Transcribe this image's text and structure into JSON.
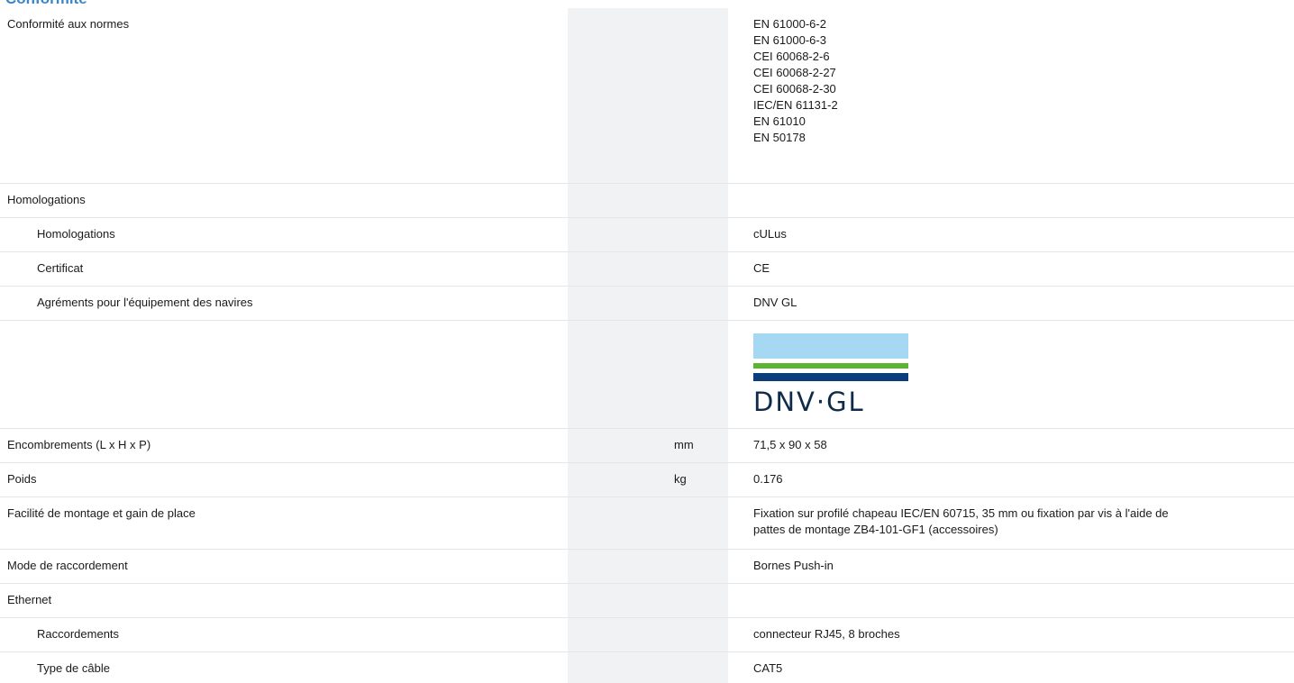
{
  "section": {
    "heading": "Conformité"
  },
  "rows": {
    "r0": {
      "label": "Conformité aux normes",
      "values": [
        "EN 61000-6-2",
        "EN 61000-6-3",
        "CEI 60068-2-6",
        "CEI 60068-2-27",
        "CEI 60068-2-30",
        "IEC/EN 61131-2",
        "EN 61010",
        "EN 50178"
      ]
    },
    "r1": {
      "label": "Homologations",
      "value": ""
    },
    "r2": {
      "label": "Homologations",
      "value": "cULus"
    },
    "r3": {
      "label": "Certificat",
      "value": "CE"
    },
    "r4": {
      "label": "Agréments pour l'équipement des navires",
      "value": "DNV GL"
    },
    "r5": {
      "logo_text": "DNV·GL",
      "logo_colors": {
        "sky": "#a6d8f4",
        "green": "#5cb531",
        "navy": "#0a3d7a",
        "text": "#0f2b4a"
      }
    },
    "r6": {
      "label": "Encombrements (L x H x P)",
      "unit": "mm",
      "value": "71,5 x 90 x 58"
    },
    "r7": {
      "label": "Poids",
      "unit": "kg",
      "value": "0.176"
    },
    "r8": {
      "label": "Facilité de montage et gain de place",
      "values": [
        "Fixation sur profilé chapeau IEC/EN 60715, 35 mm ou fixation par vis à l'aide de",
        "pattes de montage ZB4-101-GF1 (accessoires)"
      ]
    },
    "r9": {
      "label": "Mode de raccordement",
      "value": "Bornes Push-in"
    },
    "r10": {
      "label": "Ethernet",
      "value": ""
    },
    "r11": {
      "label": "Raccordements",
      "value": "connecteur RJ45, 8 broches"
    },
    "r12": {
      "label": "Type de câble",
      "value": "CAT5"
    }
  },
  "colors": {
    "heading": "#3a86c8",
    "unit_column_bg": "#f0f2f4",
    "row_divider": "#e6e6e6"
  }
}
